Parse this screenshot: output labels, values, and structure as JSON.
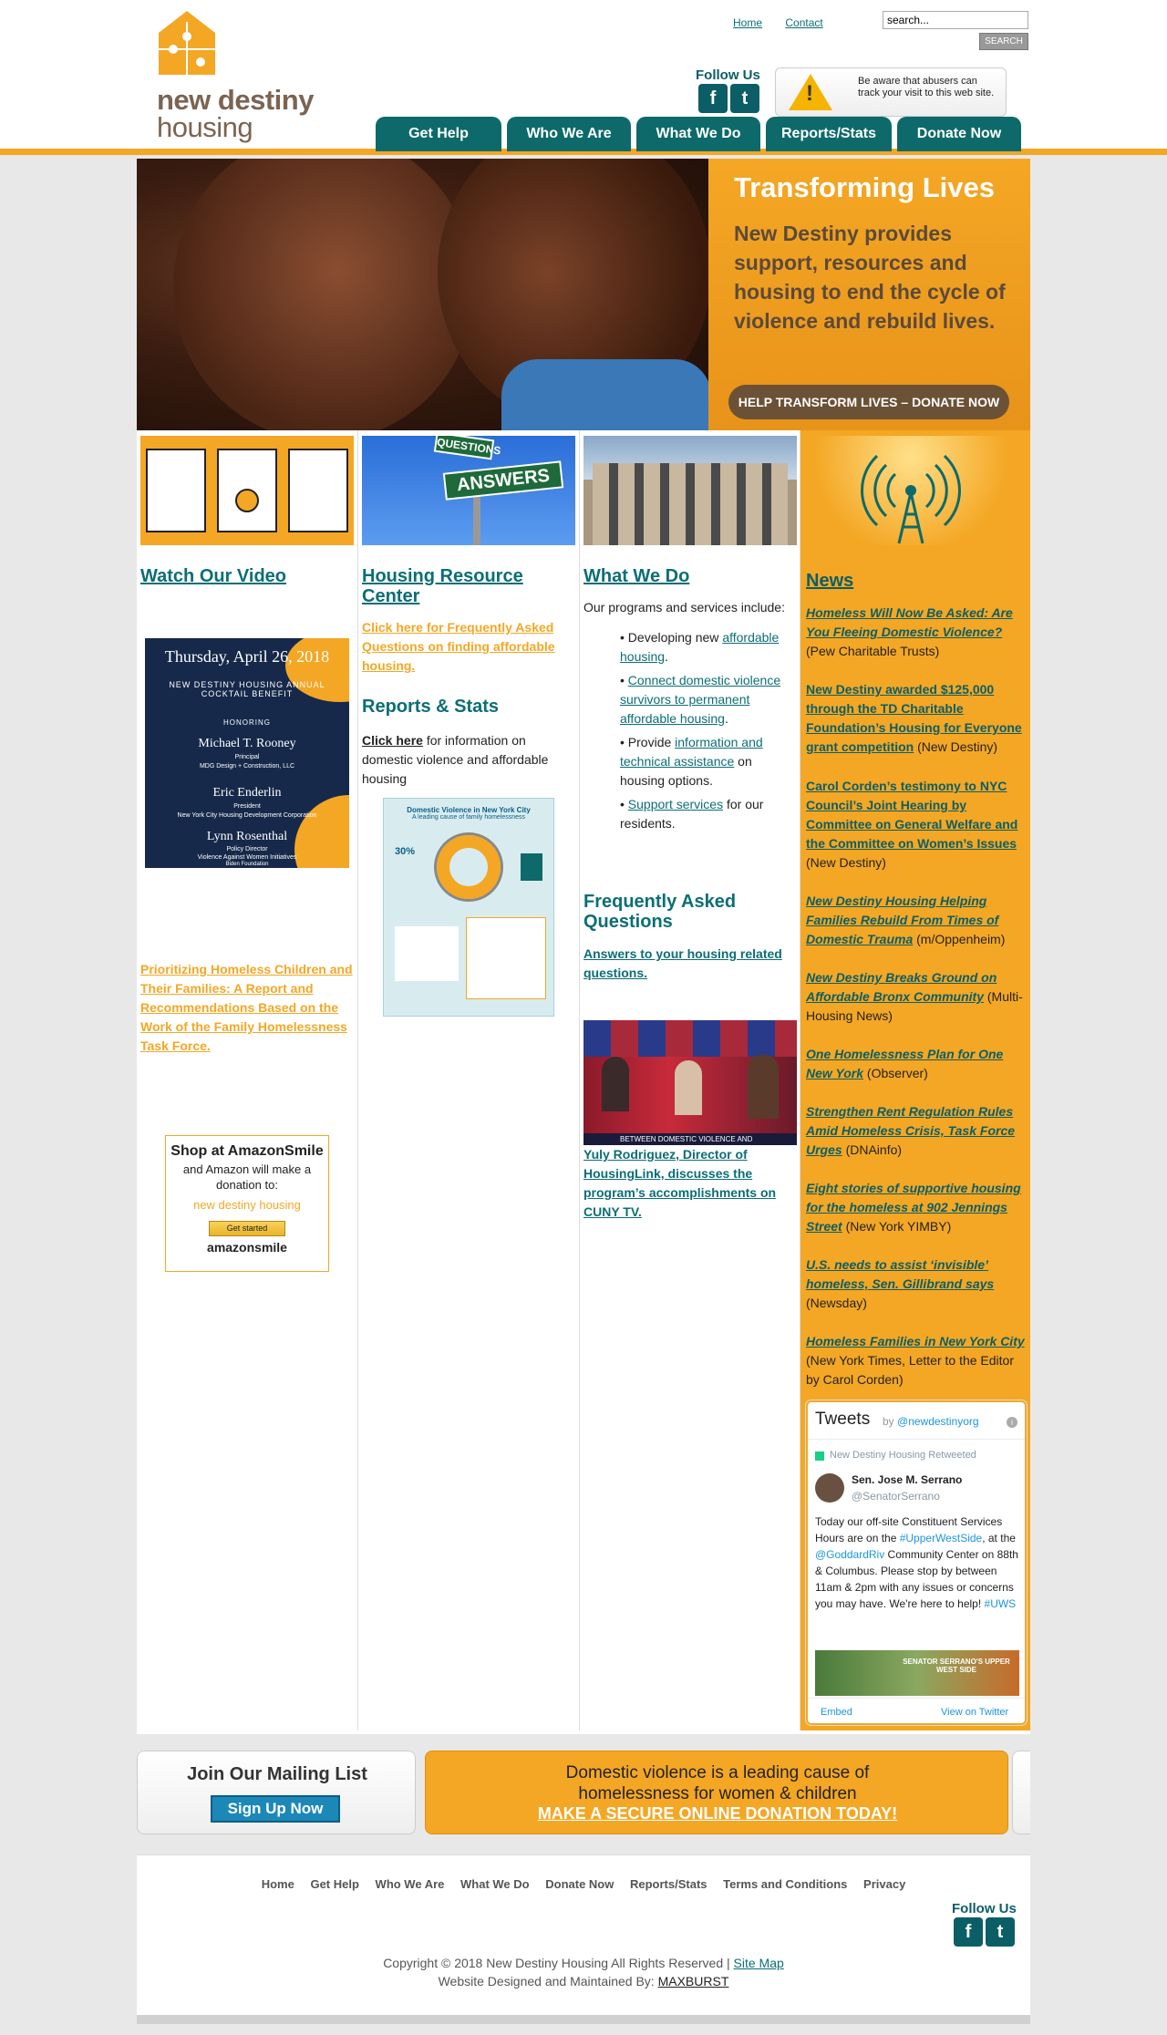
{
  "header": {
    "logo": {
      "word1": "new destiny",
      "word2": "housing"
    },
    "top_links": [
      "Home",
      "Contact"
    ],
    "search": {
      "value": "search...",
      "button": "SEARCH"
    },
    "follow_us": "Follow Us",
    "warning": "Be aware that abusers can track your visit to this web site.",
    "nav": [
      "Get Help",
      "Who We Are",
      "What We Do",
      "Reports/Stats",
      "Donate Now"
    ]
  },
  "hero": {
    "title": "Transforming Lives",
    "text": "New Destiny provides support, resources and housing to end the cycle of violence and rebuild lives.",
    "button": "HELP TRANSFORM LIVES – DONATE NOW"
  },
  "col1": {
    "title": "Watch Our Video",
    "invite": {
      "date": "Thursday, April 26, 2018",
      "event": "NEW DESTINY HOUSING ANNUAL COCKTAIL BENEFIT",
      "honoring": "HONORING",
      "h1": "Michael T. Rooney",
      "h1r": "Principal",
      "h1o": "MDG Design + Construction, LLC",
      "h2": "Eric Enderlin",
      "h2r": "President",
      "h2o": "New York City Housing Development Corporation",
      "h3": "Lynn Rosenthal",
      "h3r": "Policy Director",
      "h3o": "Violence Against Women Initiatives",
      "h3o2": "Biden Foundation"
    },
    "report_link": "Prioritizing Homeless Children and Their Families: A Report and Recommendations Based on the Work of the Family Homelessness Task Force.",
    "amazon": {
      "l1": "Shop at AmazonSmile",
      "l2": "and Amazon will make a donation to:",
      "l3": "new destiny housing",
      "btn": "Get started",
      "logo": "amazonsmile"
    }
  },
  "col2": {
    "img_sign1": "QUESTIONS",
    "img_sign2": "ANSWERS",
    "title": "Housing Resource Center",
    "faq_link": "Click here for Frequently Asked Questions on finding affordable housing.",
    "reports_title": "Reports & Stats",
    "click_here": "Click here",
    "reports_text": " for information on domestic violence and affordable housing",
    "infographic": {
      "title": "Domestic Violence in New York City",
      "subtitle": "A leading cause of family homelessness",
      "stat": "30%"
    }
  },
  "col3": {
    "title": "What We Do",
    "intro": "Our programs and services include:",
    "b1a": "Developing new ",
    "b1l": "affordable housing",
    "b1b": ".",
    "b2l": "Connect domestic violence survivors to permanent affordable housing",
    "b2b": ".",
    "b3a": "Provide ",
    "b3l": "information and technical assistance",
    "b3b": " on housing options.",
    "b4l": "Support services",
    "b4b": " for our residents.",
    "faq_title": "Frequently Asked Questions",
    "faq_link": "Answers to your housing related questions.",
    "video_caption": "BETWEEN DOMESTIC VIOLENCE AND",
    "video_link": "Yuly Rodriguez, Director of HousingLink, discusses the program’s accomplishments on CUNY TV."
  },
  "news": {
    "title": "News",
    "items": [
      {
        "link": "Homeless Will Now Be Asked: Are You Fleeing Domestic Violence?",
        "src": " (Pew Charitable Trusts)"
      },
      {
        "link": "New Destiny awarded $125,000 through the TD Charitable Foundation’s Housing for Everyone grant competition",
        "src": " (New Destiny)"
      },
      {
        "link": "Carol Corden’s testimony to NYC Council’s Joint Hearing by Committee on General Welfare and the Committee on Women’s Issues",
        "src": " (New Destiny)"
      },
      {
        "link": "New Destiny Housing Helping Families Rebuild From Times of Domestic Trauma",
        "src": " (m/Oppenheim)"
      },
      {
        "link": "New Destiny Breaks Ground on Affordable Bronx Community",
        "src": " (Multi-Housing News)"
      },
      {
        "link": "One Homelessness Plan for One New York",
        "src": " (Observer)"
      },
      {
        "link": "Strengthen Rent Regulation Rules Amid Homeless Crisis, Task Force Urges",
        "src": " (DNAinfo)"
      },
      {
        "link": "Eight stories of supportive housing for the homeless at 902 Jennings Street",
        "src": " (New York YIMBY)"
      },
      {
        "link": "U.S. needs to assist ‘invisible’ homeless, Sen. Gillibrand says",
        "src": " (Newsday)"
      },
      {
        "link": "Homeless Families in New York City",
        "src": " (New York Times, Letter to the Editor by Carol Corden)"
      }
    ]
  },
  "tweets": {
    "title": "Tweets",
    "by": "by ",
    "handle": "@newdestinyorg",
    "retweeted": "New Destiny Housing Retweeted",
    "author": "Sen. Jose M. Serrano",
    "author_handle": "@SenatorSerrano",
    "t1": "Today our off-site Constituent Services Hours are on the ",
    "tag1": "#UpperWestSide",
    "t2": ", at the ",
    "mention": "@GoddardRiv",
    "t3": " Community Center on 88th & Columbus. Please stop by between 11am & 2pm with any issues or concerns you may have. We're here to help! ",
    "tag2": "#UWS",
    "img_text": "SENATOR SERRANO'S UPPER WEST SIDE",
    "embed": "Embed",
    "view": "View on Twitter"
  },
  "mailing": {
    "title": "Join Our Mailing List",
    "button": "Sign Up Now"
  },
  "donate": {
    "line1": "Domestic violence is a leading cause of",
    "line2": "homelessness for women & children",
    "cta": "MAKE A SECURE ONLINE DONATION TODAY!"
  },
  "footer": {
    "links": [
      "Home",
      "Get Help",
      "Who We Are",
      "What We Do",
      "Donate Now",
      "Reports/Stats",
      "Terms and Conditions",
      "Privacy"
    ],
    "follow_us": "Follow Us",
    "copyright": "Copyright © 2018 New Destiny Housing All Rights Reserved | ",
    "sitemap": "Site Map",
    "designed": "Website Designed and Maintained By: ",
    "maxburst": "MAXBURST"
  },
  "colors": {
    "orange": "#f4a724",
    "teal": "#0e6a6a",
    "brown": "#7b6452"
  },
  "icons": {
    "facebook": "f",
    "twitter": "t"
  }
}
